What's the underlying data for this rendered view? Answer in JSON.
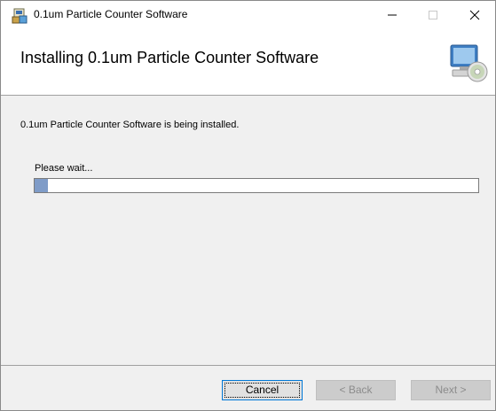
{
  "window": {
    "title": "0.1um Particle Counter Software",
    "app_icon": "installer-package-icon",
    "controls": {
      "minimize_icon": "minimize-icon",
      "maximize_icon": "maximize-icon",
      "close_icon": "close-icon"
    }
  },
  "banner": {
    "title": "Installing 0.1um Particle Counter Software",
    "icon": "computer-disc-icon"
  },
  "content": {
    "status": "0.1um Particle Counter Software is being installed.",
    "wait_label": "Please wait...",
    "progress_fraction": 0.03,
    "progress_color": "#7f9cc8"
  },
  "buttons": {
    "cancel": "Cancel",
    "back": "< Back",
    "next": "Next >"
  }
}
